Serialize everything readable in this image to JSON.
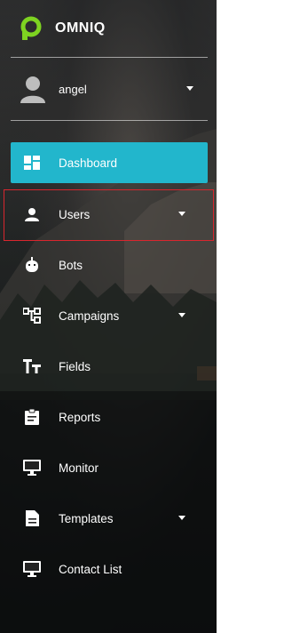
{
  "brand": {
    "name": "OMNIQ",
    "accent": "#7ed321"
  },
  "user": {
    "name": "angel"
  },
  "nav": [
    {
      "label": "Dashboard",
      "icon": "dashboard-icon",
      "active": true
    },
    {
      "label": "Users",
      "icon": "user-icon",
      "caret": true,
      "highlighted": true
    },
    {
      "label": "Bots",
      "icon": "bot-icon"
    },
    {
      "label": "Campaigns",
      "icon": "campaigns-icon",
      "caret": true
    },
    {
      "label": "Fields",
      "icon": "text-fields-icon"
    },
    {
      "label": "Reports",
      "icon": "clipboard-icon"
    },
    {
      "label": "Monitor",
      "icon": "monitor-icon"
    },
    {
      "label": "Templates",
      "icon": "document-icon",
      "caret": true
    },
    {
      "label": "Contact List",
      "icon": "monitor-icon"
    }
  ],
  "colors": {
    "active_bg": "#22b6cc",
    "highlight_border": "#d9262e",
    "text": "#ffffff"
  }
}
